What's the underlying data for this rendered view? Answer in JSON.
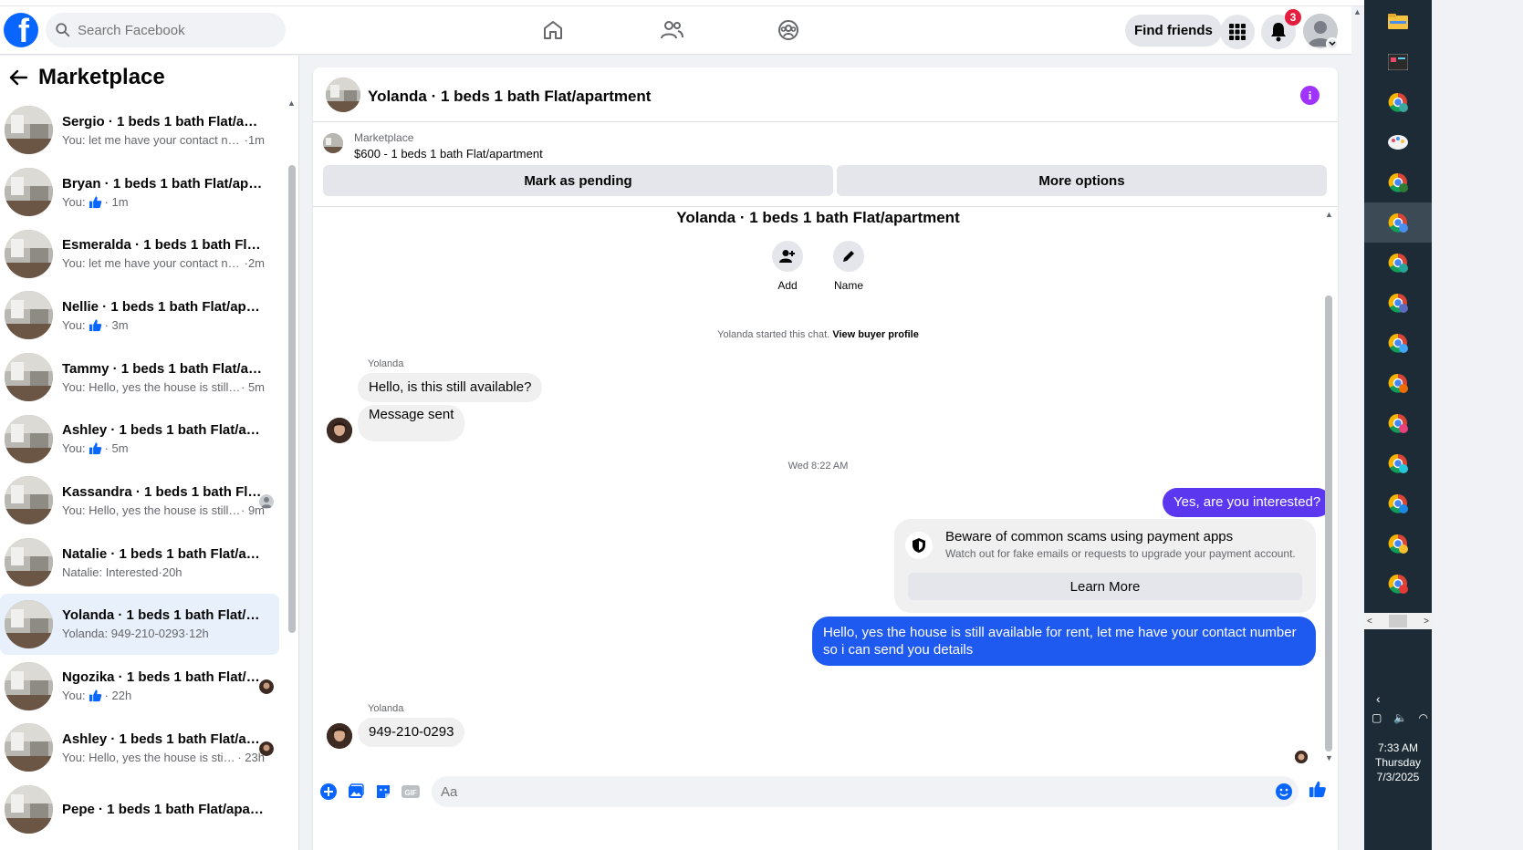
{
  "topbar": {
    "search_placeholder": "Search Facebook",
    "find_friends": "Find friends",
    "notification_count": "3"
  },
  "sidebar": {
    "title": "Marketplace",
    "conversations": [
      {
        "title": "Sergio · 1 beds 1 bath Flat/apart...",
        "snippet": "You: let me have your contact num...",
        "time": "·1m",
        "like": false,
        "seen": "none"
      },
      {
        "title": "Bryan · 1 beds 1 bath Flat/apart...",
        "snippet": "You:",
        "time": "· 1m",
        "like": true,
        "seen": "none"
      },
      {
        "title": "Esmeralda · 1 beds 1 bath Flat/a...",
        "snippet": "You: let me have your contact num...",
        "time": "·2m",
        "like": false,
        "seen": "none"
      },
      {
        "title": "Nellie · 1 beds 1 bath Flat/apart...",
        "snippet": "You:",
        "time": "· 3m",
        "like": true,
        "seen": "none"
      },
      {
        "title": "Tammy · 1 beds 1 bath Flat/apart...",
        "snippet": "You: Hello, yes the house is still av...",
        "time": "· 5m",
        "like": false,
        "seen": "none"
      },
      {
        "title": "Ashley · 1 beds 1 bath Flat/apart...",
        "snippet": "You:",
        "time": "· 5m",
        "like": true,
        "seen": "none"
      },
      {
        "title": "Kassandra · 1 beds 1 bath Flat/...",
        "snippet": "You: Hello, yes the house is still ...",
        "time": "· 9m",
        "like": false,
        "seen": "default"
      },
      {
        "title": "Natalie · 1 beds 1 bath Flat/apart...",
        "snippet": "Natalie: Interested",
        "time": "·20h",
        "like": false,
        "seen": "none"
      },
      {
        "title": "Yolanda · 1 beds 1 bath Flat/apar...",
        "snippet": "Yolanda: 949-210-0293",
        "time": "·12h",
        "like": false,
        "seen": "none",
        "active": true
      },
      {
        "title": "Ngozika · 1 beds 1 bath Flat/a...",
        "snippet": "You:",
        "time": "· 22h",
        "like": true,
        "seen": "photo"
      },
      {
        "title": "Ashley · 1 beds 1 bath Flat/apa...",
        "snippet": "You: Hello, yes the house is still...",
        "time": "· 23h",
        "like": false,
        "seen": "photo"
      },
      {
        "title": "Pepe · 1 beds 1 bath Flat/apart...",
        "snippet": "",
        "time": "",
        "like": false,
        "seen": "none"
      }
    ]
  },
  "chat": {
    "header_title": "Yolanda · 1 beds 1 bath Flat/apartment",
    "listing_label": "Marketplace",
    "listing_price": "$600 - 1 beds 1 bath Flat/apartment",
    "mark_pending": "Mark as pending",
    "more_options": "More options",
    "conversation_title": "Yolanda · 1 beds 1 bath Flat/apartment",
    "add_label": "Add",
    "name_label": "Name",
    "started_text": "Yolanda started this chat.",
    "view_profile": "View buyer profile",
    "sender": "Yolanda",
    "msg_available": "Hello, is this still available?",
    "msg_sent": "Message sent",
    "timestamp": "Wed 8:22 AM",
    "msg_interested": "Yes, are you interested?",
    "scam_title": "Beware of common scams using payment apps",
    "scam_desc": "Watch out for fake emails or requests to upgrade your payment account.",
    "learn_more": "Learn More",
    "msg_reply": "Hello, yes the house is still available for rent, let me have your contact number so i can send you details",
    "msg_phone": "949-210-0293",
    "composer_placeholder": "Aa"
  },
  "colors": {
    "brand_blue": "#0866ff",
    "outgoing_gradient_top": "#5b38ef",
    "outgoing_blue": "#1f5af0",
    "info_purple": "#a033ff",
    "active_conv_bg": "#e7f0fb"
  },
  "taskbar": {
    "time": "7:33 AM",
    "day": "Thursday",
    "date": "7/3/2025"
  }
}
